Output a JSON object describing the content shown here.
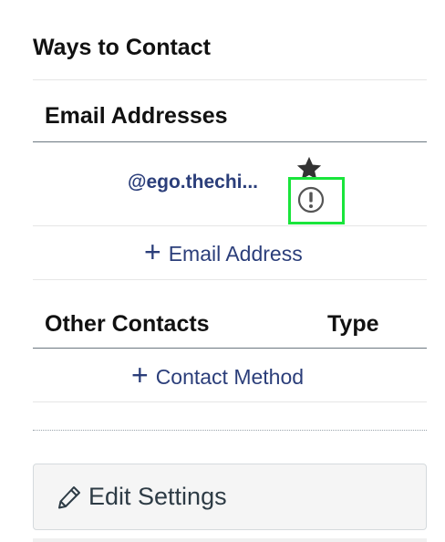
{
  "page_title": "Ways to Contact",
  "email_section": {
    "heading": "Email Addresses",
    "emails": [
      {
        "address": "@ego.thechi..."
      }
    ],
    "add_label": "Email Address"
  },
  "other_section": {
    "heading": "Other Contacts",
    "type_heading": "Type",
    "add_label": "Contact Method"
  },
  "edit_button": {
    "label": "Edit Settings"
  },
  "icons": {
    "star": "star-icon",
    "alert": "alert-circle-icon",
    "plus": "plus-icon",
    "pencil": "pencil-icon"
  },
  "colors": {
    "link": "#2b3e7a",
    "highlight": "#19e53b",
    "button_bg": "#f5f5f5"
  }
}
